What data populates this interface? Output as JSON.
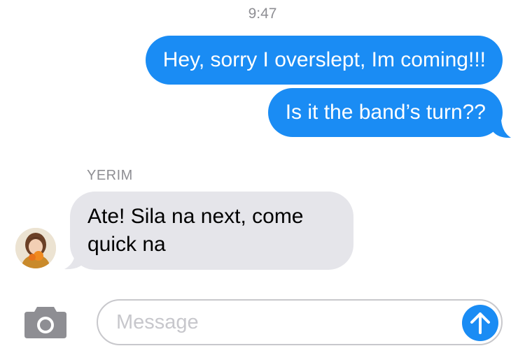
{
  "thread": {
    "timestamp": "9:47",
    "outgoing": [
      {
        "text": "Hey, sorry I overslept, Im coming!!!"
      },
      {
        "text": "Is it the band’s turn??"
      }
    ],
    "incoming": {
      "sender": "YERIM",
      "lines": [
        "Ate! Sila na next, come",
        "quick na"
      ]
    }
  },
  "composer": {
    "placeholder": "Message",
    "value": "",
    "camera_icon": "camera-icon",
    "send_icon": "arrow-up-icon"
  },
  "colors": {
    "outgoing_bubble": "#1a8cf4",
    "incoming_bubble": "#e5e5ea",
    "meta_text": "#8e8e93",
    "camera_icon": "#8e8e93"
  }
}
